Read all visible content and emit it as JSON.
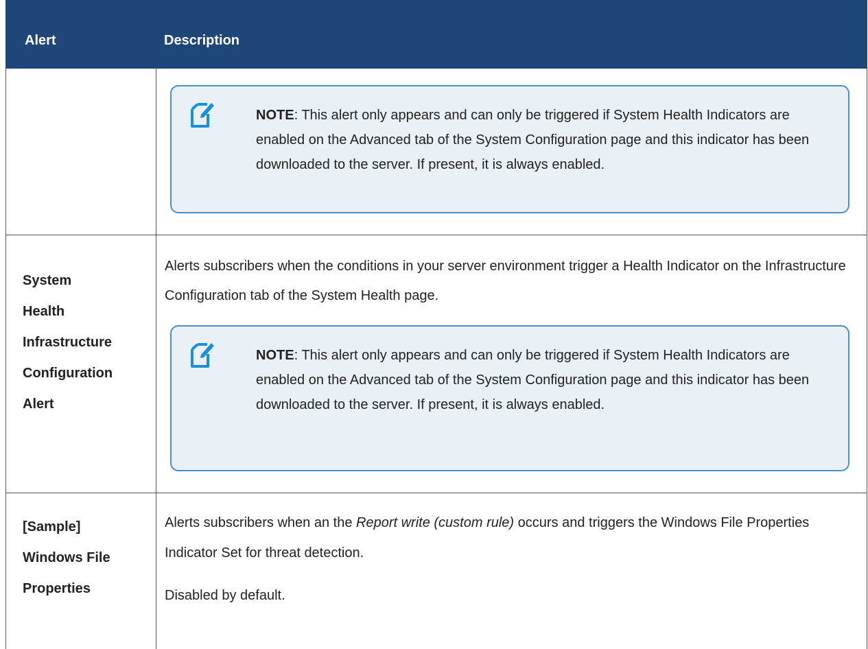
{
  "table": {
    "headers": {
      "alert": "Alert",
      "description": "Description"
    },
    "rows": [
      {
        "alert_lines": [],
        "note": {
          "label": "NOTE",
          "text": ":  This alert only appears and can only be triggered if System Health Indicators are enabled on the Advanced tab of the System Configuration page and this indicator has been downloaded to the server. If present, it is always enabled."
        }
      },
      {
        "alert_lines": [
          "System",
          "Health",
          "Infrastructure",
          "Configuration",
          "Alert"
        ],
        "description": "Alerts subscribers when the conditions in your server environment trigger a Health Indicator on the Infrastructure Configuration tab of the System Health page.",
        "note": {
          "label": "NOTE",
          "text": ":  This alert only appears and can only be triggered if System Health Indicators are enabled on the Advanced tab of the System Configuration page and this indicator has been downloaded to the server. If present, it is always enabled."
        }
      },
      {
        "alert_lines": [
          "[Sample]",
          "Windows File",
          "Properties"
        ],
        "description_before": "Alerts subscribers when an the ",
        "description_italic": "Report write (custom rule)",
        "description_after": " occurs and triggers the Windows File Properties Indicator Set for threat detection.",
        "extra": "Disabled by default."
      }
    ]
  },
  "icons": {
    "note_icon": "note-edit-icon"
  },
  "colors": {
    "header_bg": "#1f4678",
    "note_border": "#4a90c8",
    "note_bg": "#e9f0f6"
  }
}
